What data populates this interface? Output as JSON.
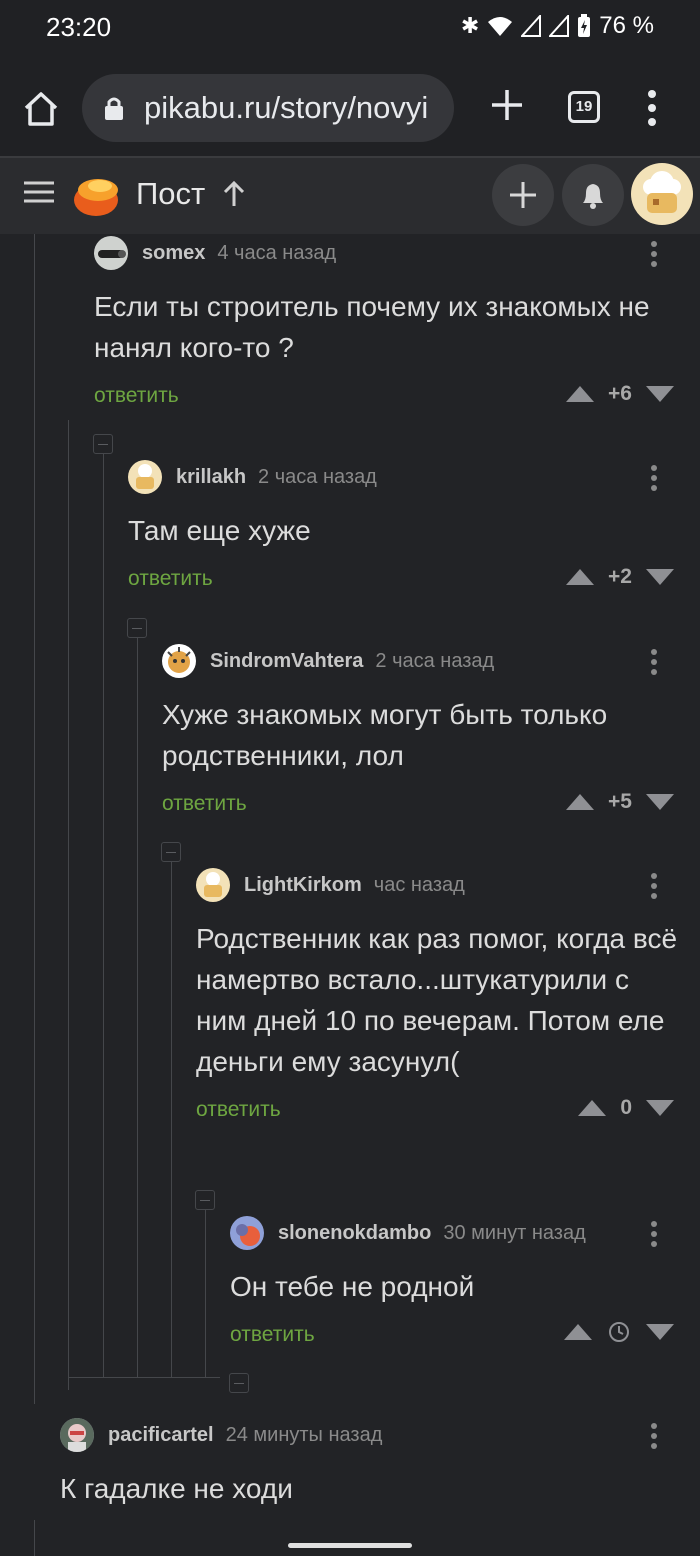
{
  "status": {
    "time": "23:20",
    "battery": "76 %"
  },
  "browser": {
    "url": "pikabu.ru/story/novyi",
    "tab_count": "19"
  },
  "header": {
    "title": "Пост"
  },
  "comments": [
    {
      "user": "somex",
      "time": "4 часа назад",
      "text": "Если ты строитель почему их знакомых не нанял кого-то ?",
      "reply": "ответить",
      "score": "+6"
    },
    {
      "user": "krillakh",
      "time": "2 часа назад",
      "text": "Там еще хуже",
      "reply": "ответить",
      "score": "+2"
    },
    {
      "user": "SindromVahtera",
      "time": "2 часа назад",
      "text": "Хуже знакомых могут быть только родственники, лол",
      "reply": "ответить",
      "score": "+5"
    },
    {
      "user": "LightKirkom",
      "time": "час назад",
      "text": "Родственник как раз помог, когда всё намертво встало...штукатурили с ним дней 10 по вечерам. Потом еле деньги ему засунул(",
      "reply": "ответить",
      "score": "0"
    },
    {
      "user": "slonenokdambo",
      "time": "30 минут назад",
      "text": "Он тебе не родной",
      "reply": "ответить",
      "score": ""
    },
    {
      "user": "pacificartel",
      "time": "24 минуты назад",
      "text": "К гадалке не ходи",
      "reply": "",
      "score": ""
    }
  ],
  "colors": {
    "background": "#222326",
    "reply_link": "#6ea641",
    "header_bg": "#2b2c2f"
  }
}
